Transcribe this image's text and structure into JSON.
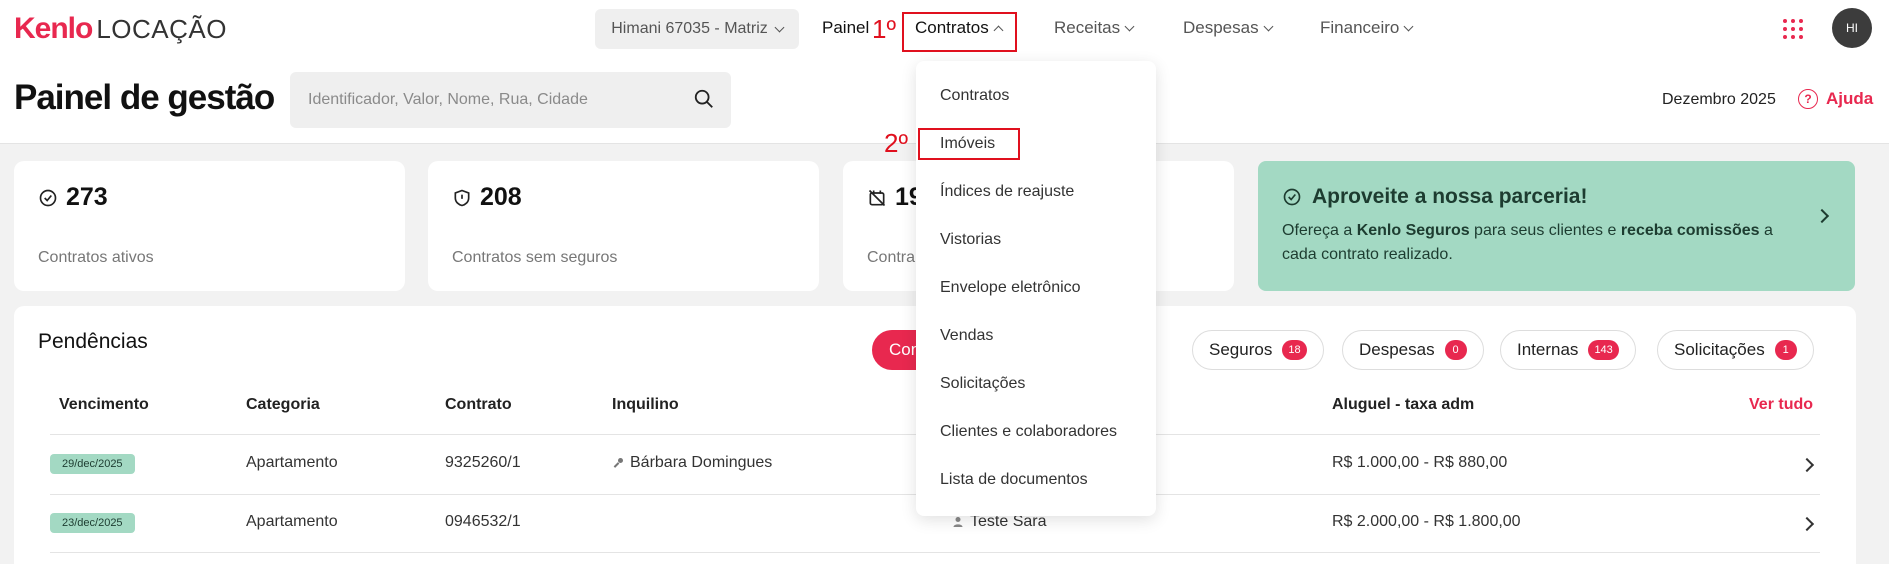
{
  "brand": {
    "name": "Kenlo",
    "product": "LOCAÇÃO"
  },
  "topnav": {
    "branch": "Himani 67035 - Matriz",
    "items": [
      "Painel",
      "Contratos",
      "Receitas",
      "Despesas",
      "Financeiro"
    ],
    "avatar": "HI"
  },
  "header": {
    "title": "Painel de gestão",
    "search_placeholder": "Identificador, Valor, Nome, Rua, Cidade",
    "month": "Dezembro 2025",
    "help": "Ajuda"
  },
  "cards": [
    {
      "value": "273",
      "label": "Contratos ativos",
      "icon": "check-circle-icon"
    },
    {
      "value": "208",
      "label": "Contratos sem seguros",
      "icon": "shield-icon"
    },
    {
      "value": "19",
      "label": "Contra",
      "icon": "calendar-off-icon"
    }
  ],
  "promo": {
    "title": "Aproveite a nossa parceria!",
    "text_a": "Ofereça a ",
    "text_b": "Kenlo Seguros",
    "text_c": " para seus clientes e ",
    "text_d": "receba comissões",
    "text_e": " a cada contrato realizado."
  },
  "pendencias": {
    "title": "Pendências",
    "tabs": [
      {
        "label": "Con",
        "badge": ""
      },
      {
        "label": "Seguros",
        "badge": "18"
      },
      {
        "label": "Despesas",
        "badge": "0"
      },
      {
        "label": "Internas",
        "badge": "143"
      },
      {
        "label": "Solicitações",
        "badge": "1"
      }
    ],
    "columns": [
      "Vencimento",
      "Categoria",
      "Contrato",
      "Inquilino",
      "Aluguel - taxa adm"
    ],
    "see_all": "Ver tudo",
    "rows": [
      {
        "date": "29/dec/2025",
        "category": "Apartamento",
        "contract": "9325260/1",
        "tenant": "Bárbara Domingues",
        "owner": "",
        "rent": "R$ 1.000,00 - R$ 880,00"
      },
      {
        "date": "23/dec/2025",
        "category": "Apartamento",
        "contract": "0946532/1",
        "tenant": "",
        "owner": "Teste Sara",
        "rent": "R$ 2.000,00 - R$ 1.800,00"
      }
    ]
  },
  "dropdown": {
    "items": [
      "Contratos",
      "Imóveis",
      "Índices de reajuste",
      "Vistorias",
      "Envelope eletrônico",
      "Vendas",
      "Solicitações",
      "Clientes e colaboradores",
      "Lista de documentos"
    ]
  },
  "annotations": {
    "step1": "1º",
    "step2": "2º"
  },
  "colors": {
    "accent": "#e8284f",
    "promo_bg": "#a3d9c3",
    "annotation": "#e0101e"
  }
}
